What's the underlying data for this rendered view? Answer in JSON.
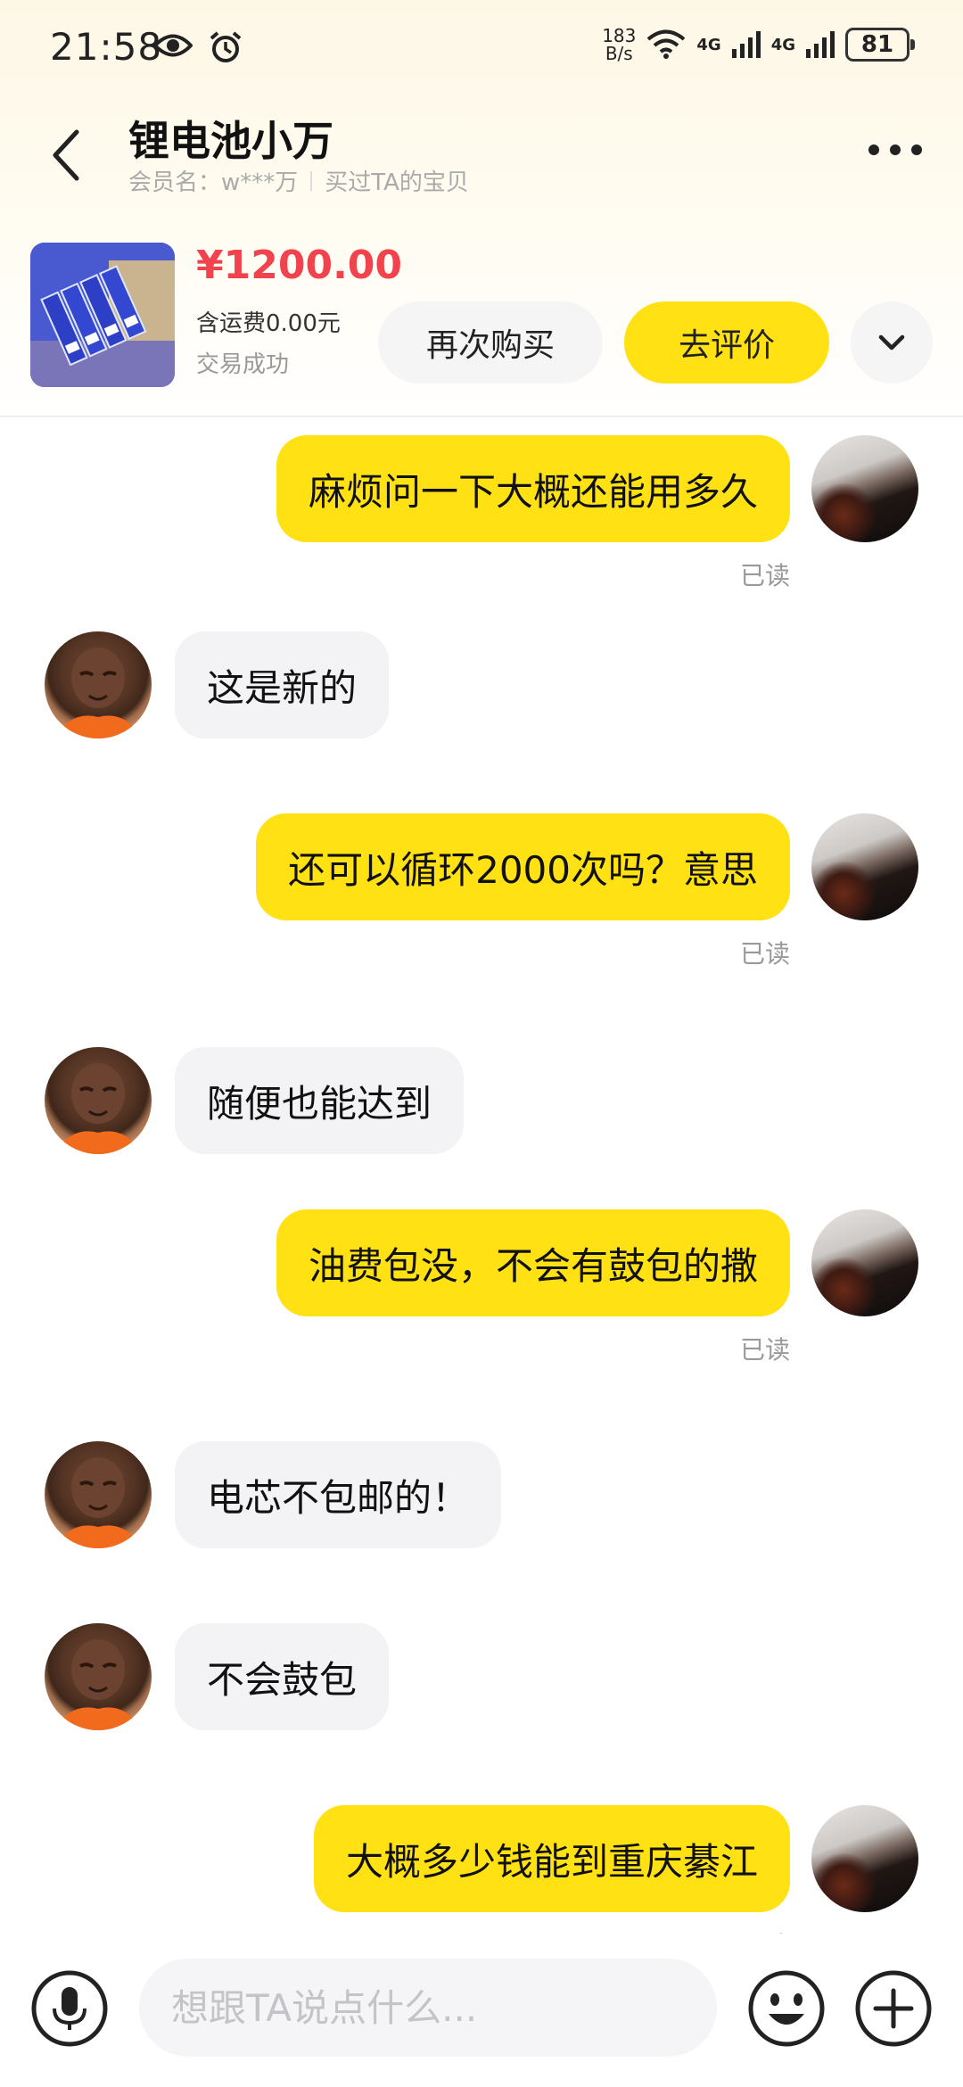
{
  "status_bar": {
    "time": "21:58",
    "net_speed_value": "183",
    "net_speed_unit": "B/s",
    "network_1": "4G",
    "network_2": "4G",
    "battery": "81"
  },
  "header": {
    "contact_name": "锂电池小万",
    "member_label": "会员名：",
    "member_name": "w***万",
    "purchase_note": "买过TA的宝贝"
  },
  "product": {
    "price": "¥1200.00",
    "shipping": "含运费0.00元",
    "status": "交易成功",
    "rebuy_label": "再次购买",
    "review_label": "去评价"
  },
  "messages": [
    {
      "sender": "me",
      "text": "麻烦问一下大概还能用多久",
      "status": "已读"
    },
    {
      "sender": "them",
      "text": "这是新的"
    },
    {
      "sender": "me",
      "text": "还可以循环2000次吗？意思",
      "status": "已读"
    },
    {
      "sender": "them",
      "text": "随便也能达到"
    },
    {
      "sender": "me",
      "text": "油费包没，不会有鼓包的撒",
      "status": "已读"
    },
    {
      "sender": "them",
      "text": "电芯不包邮的！"
    },
    {
      "sender": "them",
      "text": "不会鼓包"
    },
    {
      "sender": "me",
      "text": "大概多少钱能到重庆綦江",
      "status": "已读"
    }
  ],
  "input": {
    "placeholder": "想跟TA说点什么..."
  },
  "colors": {
    "accent": "#ffe114",
    "price": "#f0434d",
    "bubble_other": "#f3f3f5"
  }
}
